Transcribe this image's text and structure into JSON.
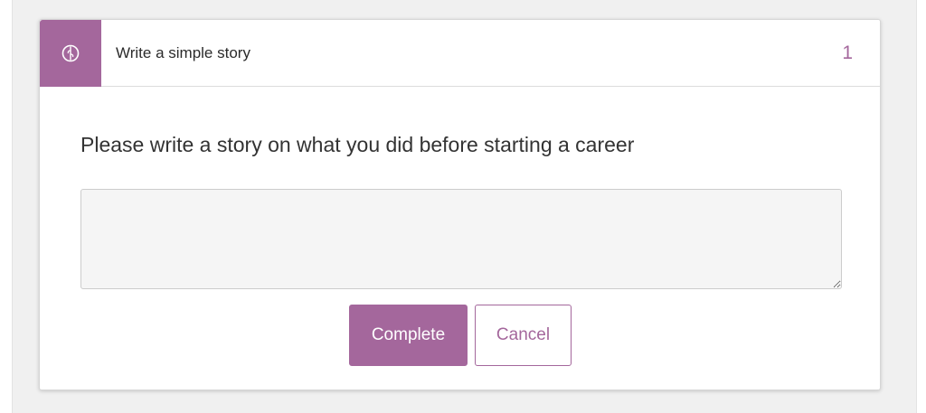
{
  "task": {
    "icon": "brain-icon",
    "title": "Write a simple story",
    "count": "1"
  },
  "question": {
    "prompt": "Please write a story on what you did before starting a career",
    "answer_value": "",
    "answer_placeholder": ""
  },
  "actions": {
    "complete_label": "Complete",
    "cancel_label": "Cancel"
  },
  "colors": {
    "accent": "#a4679c",
    "background": "#f0f0f0",
    "card": "#ffffff",
    "textarea": "#f5f5f5"
  }
}
